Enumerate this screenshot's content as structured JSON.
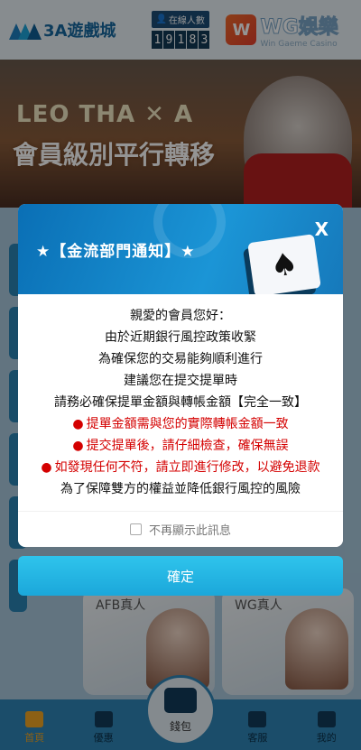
{
  "header": {
    "logo_text": "3A遊戲城",
    "online_label": "在線人數",
    "online_digits": [
      "1",
      "9",
      "1",
      "8",
      "3"
    ],
    "partner_logo": "WG娛樂",
    "partner_sub": "Win Gaeme Casino"
  },
  "banner": {
    "brand_line": "LEO THA ✕ A",
    "headline": "會員級別平行轉移"
  },
  "cards": [
    {
      "label": "AFB真人"
    },
    {
      "label": "WG真人"
    }
  ],
  "nav": {
    "items": [
      {
        "label": "首頁",
        "icon": "home-icon"
      },
      {
        "label": "優惠",
        "icon": "gift-icon"
      },
      {
        "label": "客服",
        "icon": "headset-icon"
      },
      {
        "label": "我的",
        "icon": "user-icon"
      }
    ],
    "center": {
      "label": "錢包",
      "icon": "wallet-icon"
    }
  },
  "modal": {
    "title": "★【金流部門通知】★",
    "close": "X",
    "lines": [
      "親愛的會員您好：",
      "由於近期銀行風控政策收緊",
      "為確保您的交易能夠順利進行",
      "建議您在提交提單時",
      "請務必確保提單金額與轉帳金額【完全一致】"
    ],
    "warnings": [
      "提單金額需與您的實際轉帳金額一致",
      "提交提單後，請仔細檢查，確保無誤",
      "如發現任何不符，請立即進行修改，以避免退款"
    ],
    "cut_line": "為了保障雙方的權益並降低銀行風控的風險",
    "dont_show": "不再顯示此訊息",
    "confirm": "確定"
  },
  "colors": {
    "primary": "#1b95d6",
    "warning": "#d40000",
    "confirm": "#1ba7da"
  }
}
